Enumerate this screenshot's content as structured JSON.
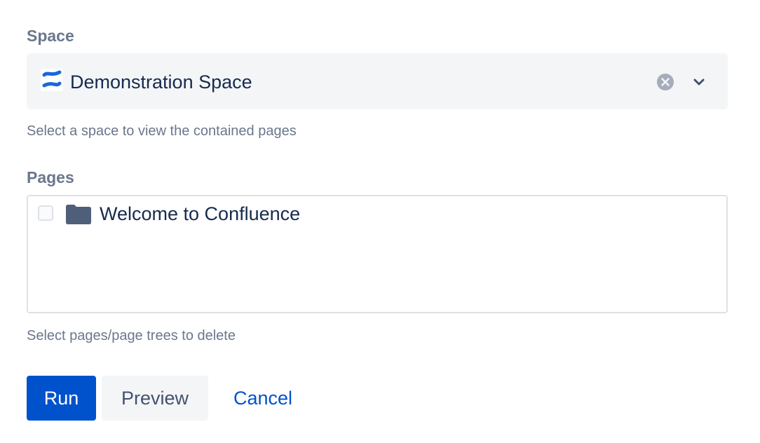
{
  "space_field": {
    "label": "Space",
    "selected_value": "Demonstration Space",
    "selected_icon": "confluence-logo-icon",
    "helper_text": "Select a space to view the contained pages"
  },
  "pages_field": {
    "label": "Pages",
    "items": [
      {
        "label": "Welcome to Confluence",
        "checked": false,
        "icon": "folder-icon"
      }
    ],
    "helper_text": "Select pages/page trees to delete"
  },
  "actions": {
    "run_label": "Run",
    "preview_label": "Preview",
    "cancel_label": "Cancel"
  },
  "colors": {
    "primary": "#0052cc",
    "label_gray": "#6b778c",
    "text_dark": "#172b4d",
    "field_bg": "#f4f5f7"
  }
}
